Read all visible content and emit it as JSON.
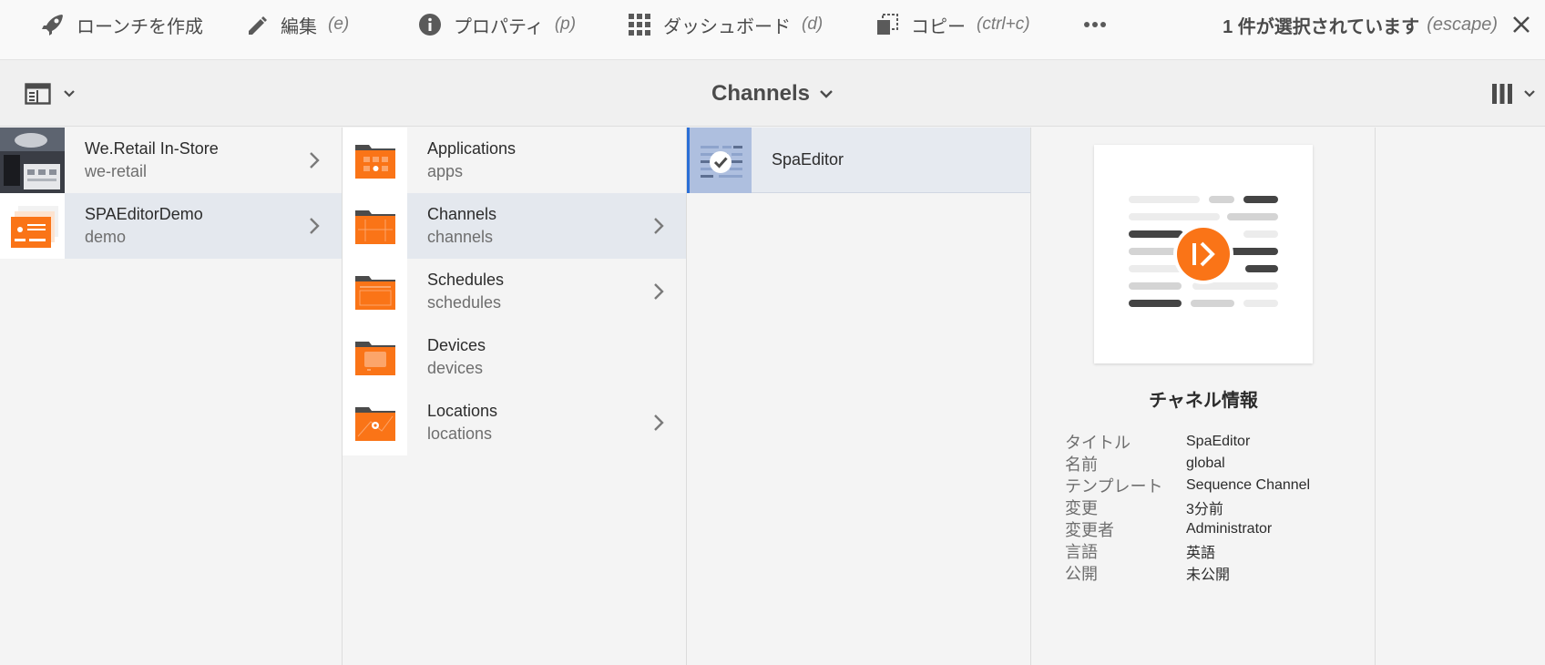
{
  "actionbar": {
    "actions": [
      {
        "label": "ローンチを作成",
        "shortcut": "",
        "icon": "rocket-icon"
      },
      {
        "label": "編集",
        "shortcut": "(e)",
        "icon": "pencil-icon"
      },
      {
        "label": "プロパティ",
        "shortcut": "(p)",
        "icon": "info-icon"
      },
      {
        "label": "ダッシュボード",
        "shortcut": "(d)",
        "icon": "grid-icon"
      },
      {
        "label": "コピー",
        "shortcut": "(ctrl+c)",
        "icon": "copy-icon"
      }
    ],
    "more_icon": "more-icon",
    "selection_text": "1 件が選択されています",
    "selection_shortcut": "(escape)",
    "close_icon": "close-icon"
  },
  "titlebar": {
    "title": "Channels",
    "rail_icon": "side-rail-icon",
    "view_icon": "column-view-icon"
  },
  "columns": {
    "col1": [
      {
        "title": "We.Retail In-Store",
        "name": "we-retail",
        "has_children": true,
        "selected": false
      },
      {
        "title": "SPAEditorDemo",
        "name": "demo",
        "has_children": true,
        "selected": true
      }
    ],
    "col2": [
      {
        "title": "Applications",
        "name": "apps",
        "has_children": false,
        "selected": false
      },
      {
        "title": "Channels",
        "name": "channels",
        "has_children": true,
        "selected": true
      },
      {
        "title": "Schedules",
        "name": "schedules",
        "has_children": true,
        "selected": false
      },
      {
        "title": "Devices",
        "name": "devices",
        "has_children": false,
        "selected": false
      },
      {
        "title": "Locations",
        "name": "locations",
        "has_children": true,
        "selected": false
      }
    ],
    "col3": [
      {
        "title": "SpaEditor",
        "checked": true
      }
    ]
  },
  "details": {
    "heading": "チャネル情報",
    "rows": [
      {
        "key": "タイトル",
        "value": "SpaEditor"
      },
      {
        "key": "名前",
        "value": "global"
      },
      {
        "key": "テンプレート",
        "value": "Sequence Channel"
      },
      {
        "key": "変更",
        "value": "3分前"
      },
      {
        "key": "変更者",
        "value": "Administrator"
      },
      {
        "key": "言語",
        "value": "英語"
      },
      {
        "key": "公開",
        "value": "未公開"
      }
    ]
  },
  "colors": {
    "folder_orange": "#fa7417",
    "folder_tab_dark": "#4b4b4b",
    "selected_row": "#e4e8ee",
    "checked_thumb": "#aebfdf",
    "accent_blue": "#2b6fd6"
  }
}
